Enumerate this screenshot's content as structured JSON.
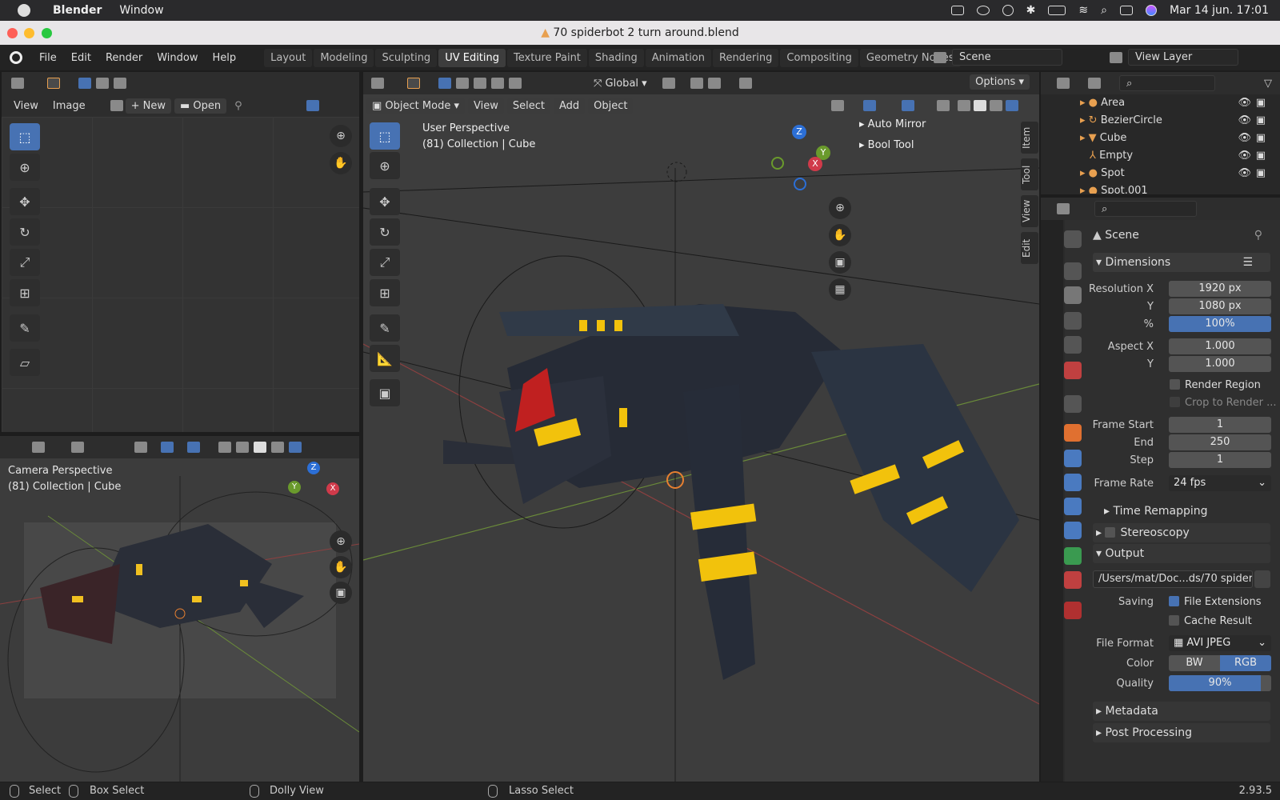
{
  "macbar": {
    "app": "Blender",
    "menu": "Window",
    "datetime": "Mar 14 jun.  17:01"
  },
  "window": {
    "title": "70 spiderbot 2 turn around.blend"
  },
  "topmenu": {
    "items": [
      "File",
      "Edit",
      "Render",
      "Window",
      "Help"
    ],
    "workspaces": [
      "Layout",
      "Modeling",
      "Sculpting",
      "UV Editing",
      "Texture Paint",
      "Shading",
      "Animation",
      "Rendering",
      "Compositing",
      "Geometry Nodes"
    ],
    "active_workspace": "UV Editing",
    "scene": "Scene",
    "view_layer": "View Layer"
  },
  "image_editor": {
    "menus": [
      "View",
      "Image"
    ],
    "new_label": "New",
    "open_label": "Open"
  },
  "camera_view": {
    "title": "Camera Perspective",
    "subtitle": "(81) Collection | Cube"
  },
  "viewport": {
    "mode": "Object Mode",
    "menus": [
      "View",
      "Select",
      "Add",
      "Object"
    ],
    "orientation": "Global",
    "options": "Options",
    "title": "User Perspective",
    "subtitle": "(81) Collection | Cube",
    "side_panels": [
      "Auto Mirror",
      "Bool Tool"
    ],
    "tabs": [
      "Item",
      "Tool",
      "View",
      "Edit"
    ]
  },
  "gizmo": {
    "z": "Z",
    "y": "Y",
    "x": "X"
  },
  "outliner": {
    "rows": [
      "Area",
      "BezierCircle",
      "Cube",
      "Empty",
      "Spot",
      "Spot.001"
    ]
  },
  "properties": {
    "context": "Scene",
    "dimensions": "Dimensions",
    "resolution_x_label": "Resolution X",
    "resolution_x": "1920 px",
    "y_label": "Y",
    "resolution_y": "1080 px",
    "pct_label": "%",
    "resolution_pct": "100%",
    "aspect_x_label": "Aspect X",
    "aspect_x": "1.000",
    "aspect_y": "1.000",
    "render_region": "Render Region",
    "crop": "Crop to Render ...",
    "frame_start_label": "Frame Start",
    "frame_start": "1",
    "end_label": "End",
    "frame_end": "250",
    "step_label": "Step",
    "frame_step": "1",
    "frame_rate_label": "Frame Rate",
    "frame_rate": "24 fps",
    "time_remapping": "Time Remapping",
    "stereoscopy": "Stereoscopy",
    "output": "Output",
    "output_path": "/Users/mat/Doc...ds/70 spiderbot",
    "saving_label": "Saving",
    "file_extensions": "File Extensions",
    "cache_result": "Cache Result",
    "file_format_label": "File Format",
    "file_format": "AVI JPEG",
    "color_label": "Color",
    "color_bw": "BW",
    "color_rgb": "RGB",
    "quality_label": "Quality",
    "quality": "90%",
    "quality_fraction": 0.9,
    "metadata": "Metadata",
    "post_processing": "Post Processing"
  },
  "status": {
    "select": "Select",
    "box_select": "Box Select",
    "dolly": "Dolly View",
    "lasso": "Lasso Select",
    "version": "2.93.5"
  }
}
